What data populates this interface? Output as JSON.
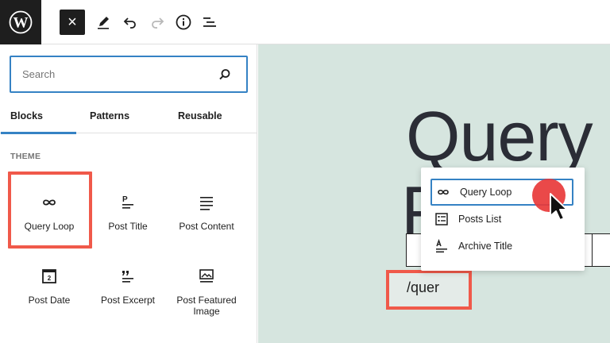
{
  "toolbar": {
    "logo_letter": "W",
    "close_label": "×",
    "icons": [
      "wordpress-logo-icon",
      "close-icon",
      "pencil-icon",
      "undo-icon",
      "redo-icon",
      "info-icon",
      "list-view-icon"
    ]
  },
  "inserter": {
    "search": {
      "placeholder": "Search",
      "value": ""
    },
    "tabs": [
      {
        "label": "Blocks",
        "active": true
      },
      {
        "label": "Patterns",
        "active": false
      },
      {
        "label": "Reusable",
        "active": false
      }
    ],
    "section_title": "THEME",
    "blocks": [
      {
        "label": "Query Loop",
        "icon": "loop-icon",
        "highlighted": true
      },
      {
        "label": "Post Title",
        "icon": "post-title-icon"
      },
      {
        "label": "Post Content",
        "icon": "post-content-icon"
      },
      {
        "label": "Post Date",
        "icon": "post-date-icon",
        "icon_text": "2"
      },
      {
        "label": "Post Excerpt",
        "icon": "post-excerpt-icon"
      },
      {
        "label": "Post Featured Image",
        "icon": "post-featured-image-icon"
      }
    ]
  },
  "canvas": {
    "heading_line1": "Query L",
    "heading_line2": "P",
    "slash_command": "/quer",
    "suggestions": [
      {
        "label": "Query Loop",
        "icon": "loop-icon",
        "selected": true
      },
      {
        "label": "Posts List",
        "icon": "posts-list-icon",
        "selected": false
      },
      {
        "label": "Archive Title",
        "icon": "archive-title-icon",
        "selected": false
      }
    ]
  },
  "colors": {
    "accent": "#3582c4",
    "highlight": "#f0594a",
    "canvas_bg": "#d6e5df",
    "cursor_dot": "#e83a3a"
  }
}
